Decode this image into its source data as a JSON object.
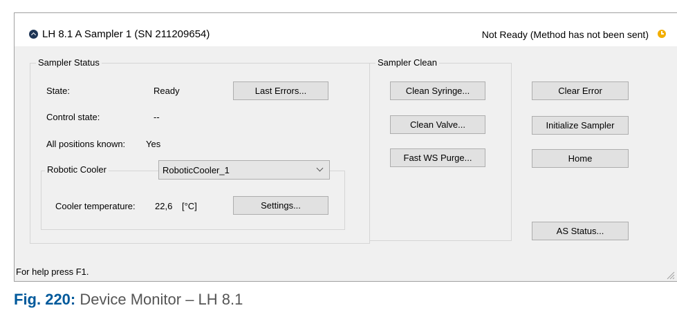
{
  "window": {
    "title": "LH 8.1 A Sampler 1 (SN 211209654)",
    "status": "Not Ready (Method has not been sent)",
    "status_icon": "clock-icon",
    "status_color": "#f2ae00"
  },
  "sampler_status": {
    "label": "Sampler Status",
    "state_label": "State:",
    "state_value": "Ready",
    "last_errors_button": "Last Errors...",
    "control_state_label": "Control state:",
    "control_state_value": "--",
    "positions_label": "All positions known:",
    "positions_value": "Yes",
    "robotic_cooler": {
      "label": "Robotic Cooler",
      "selected": "RoboticCooler_1",
      "temperature_label": "Cooler temperature:",
      "temperature_value": "22,6",
      "temperature_unit": "[°C]",
      "settings_button": "Settings..."
    }
  },
  "sampler_clean": {
    "label": "Sampler Clean",
    "clean_syringe_button": "Clean Syringe...",
    "clean_valve_button": "Clean Valve...",
    "fast_ws_purge_button": "Fast WS Purge..."
  },
  "actions": {
    "clear_error_button": "Clear Error",
    "initialize_button": "Initialize Sampler",
    "home_button": "Home",
    "as_status_button": "AS Status..."
  },
  "statusbar": {
    "help_text": "For help press F1."
  },
  "caption": {
    "number": "Fig. 220:",
    "text": "Device Monitor – LH 8.1"
  }
}
